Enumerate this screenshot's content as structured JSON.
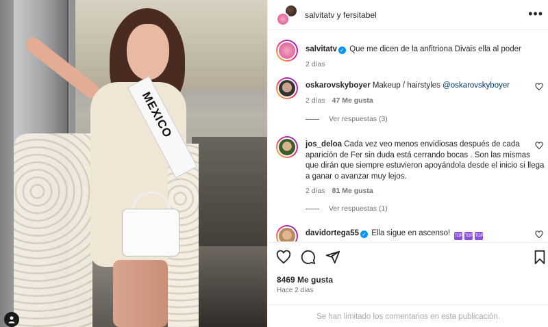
{
  "header": {
    "names": "salvitatv y fersitabel",
    "more_label": "•••"
  },
  "comments": [
    {
      "username": "salvitatv",
      "verified": true,
      "text": "Que me dicen de la anfitriona Divais ella al poder",
      "time": "2 días"
    },
    {
      "username": "oskarovskyboyer",
      "text": "Makeup / hairstyles",
      "mention": "@oskarovskyboyer",
      "time": "2 días",
      "likes": "47 Me gusta",
      "replies": "Ver respuestas (3)"
    },
    {
      "username": "jos_deloa",
      "text": "Cada vez veo menos envidiosas después de cada aparición de Fer sin duda está cerrando bocas . Son las mismas que dirán que siempre estuvieron apoyándola desde el inicio si llega a ganar o avanzar muy lejos.",
      "time": "2 días",
      "likes": "81 Me gusta",
      "replies": "Ver respuestas (1)"
    },
    {
      "username": "davidortega55",
      "verified": true,
      "text": "Ella sigue en ascenso!",
      "emoji": "TOP"
    }
  ],
  "photo": {
    "sash_text": "MEXICO"
  },
  "footer": {
    "likes": "8469 Me gusta",
    "ago": "Hace 2 días",
    "limited": "Se han limitado los comentarios en esta publicación."
  }
}
